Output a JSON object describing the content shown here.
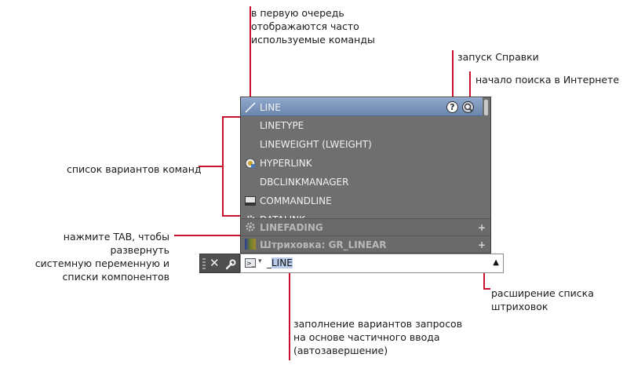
{
  "annotations": {
    "frequent": "в первую очередь\nотображаются часто\nиспользуемые команды",
    "help": "запуск Справки",
    "internet": "начало поиска в Интернете",
    "variants": "список вариантов команд",
    "tab": "нажмите TAB, чтобы развернуть\nсистемную переменную и\nсписки компонентов",
    "hatch": "расширение списка\nштриховок",
    "autocomplete": "заполнение вариантов запросов\nна основе частичного ввода\n(автозавершение)"
  },
  "list": {
    "items": [
      {
        "label": "LINE",
        "icon": "line-icon"
      },
      {
        "label": "LINETYPE",
        "icon": ""
      },
      {
        "label": "LINEWEIGHT (LWEIGHT)",
        "icon": ""
      },
      {
        "label": "HYPERLINK",
        "icon": "hyperlink-icon"
      },
      {
        "label": "DBCLINKMANAGER",
        "icon": ""
      },
      {
        "label": "COMMANDLINE",
        "icon": "commandline-icon"
      },
      {
        "label": "DATALINK",
        "icon": "gear-icon"
      }
    ],
    "help_icon": "?",
    "sections": [
      {
        "label": "LINEFADING",
        "icon": "gear-icon",
        "expand": "+"
      },
      {
        "label": "Штриховка: GR_LINEAR",
        "icon": "hatch-swatch-icon",
        "expand": "+"
      }
    ]
  },
  "commandline": {
    "close_glyph": "✕",
    "tools_glyph": "🔧",
    "prompt_glyph": ">_",
    "dropdown_glyph": "▾",
    "typed_prefix": "_",
    "typed_highlight": "LINE",
    "expand_glyph": "▲"
  },
  "colors": {
    "leader": "#c8102e",
    "panel": "#6f6f6f",
    "selected": "#7f9bc4"
  }
}
